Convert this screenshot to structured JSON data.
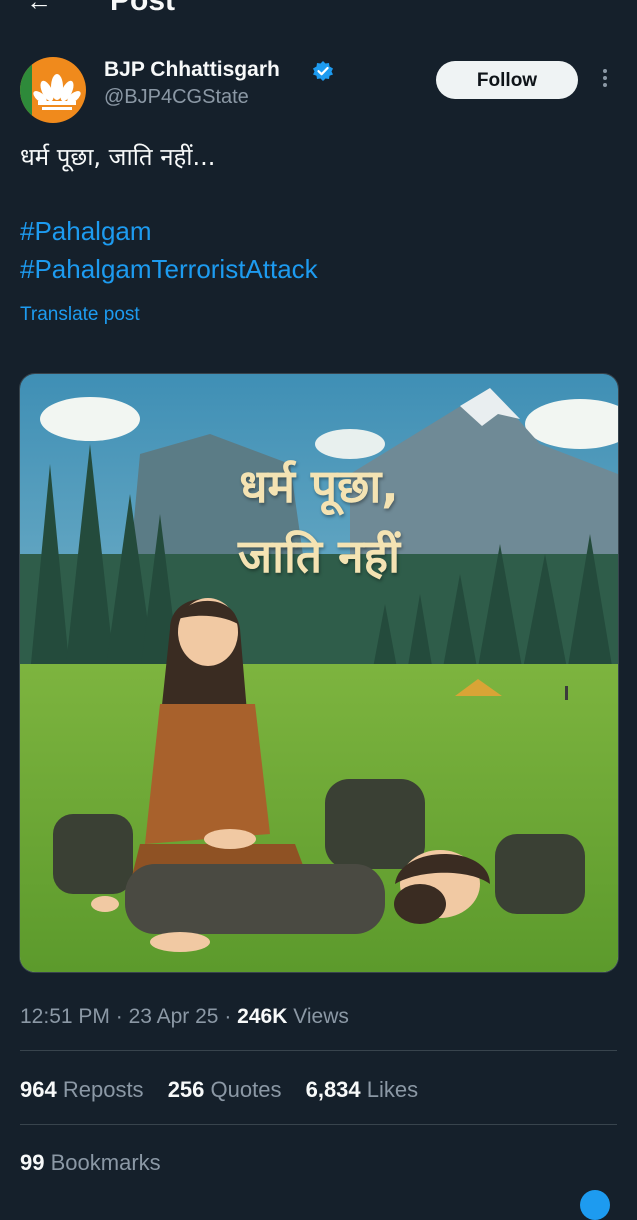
{
  "header": {
    "title": "Post",
    "back_icon": "arrow-left-icon"
  },
  "author": {
    "name": "BJP Chhattisgarh",
    "handle": "@BJP4CGState",
    "verified": true,
    "avatar_icon": "lotus-logo",
    "follow_label": "Follow"
  },
  "post": {
    "text": "धर्म पूछा, जाति नहीं...",
    "hashtags": [
      "#Pahalgam",
      "#PahalgamTerroristAttack"
    ],
    "translate_label": "Translate post",
    "image_caption_line1": "धर्म पूछा,",
    "image_caption_line2": "जाति नहीं"
  },
  "meta": {
    "time": "12:51 PM",
    "date": "23 Apr 25",
    "views_count": "246K",
    "views_label": "Views",
    "separator": "·"
  },
  "stats": {
    "reposts_count": "964",
    "reposts_label": "Reposts",
    "quotes_count": "256",
    "quotes_label": "Quotes",
    "likes_count": "6,834",
    "likes_label": "Likes",
    "bookmarks_count": "99",
    "bookmarks_label": "Bookmarks"
  },
  "colors": {
    "background": "#15202b",
    "link": "#1d9bf0",
    "muted": "#8b98a5"
  }
}
